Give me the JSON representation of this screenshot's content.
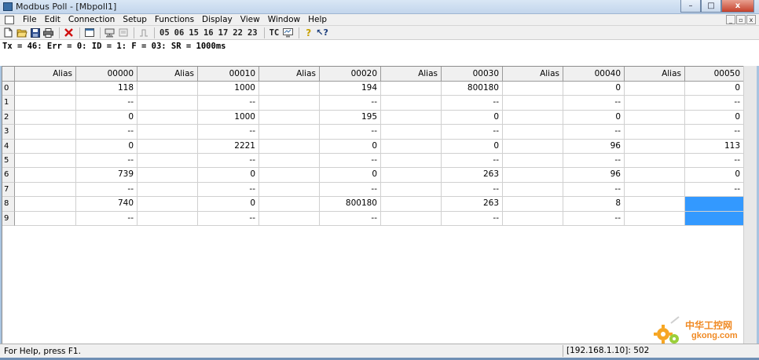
{
  "window": {
    "title": "Modbus Poll - [Mbpoll1]",
    "min_label": "–",
    "max_label": "□",
    "close_label": "x"
  },
  "menu": {
    "items": [
      "File",
      "Edit",
      "Connection",
      "Setup",
      "Functions",
      "Display",
      "View",
      "Window",
      "Help"
    ],
    "mdi_min": "_",
    "mdi_restore": "▫",
    "mdi_close": "x"
  },
  "toolbar": {
    "function_codes": [
      "05",
      "06",
      "15",
      "16",
      "17",
      "22",
      "23"
    ],
    "tc_label": "TC",
    "help_label": "?",
    "context_help_label": "↖?"
  },
  "status_line": "Tx = 46: Err = 0: ID = 1: F = 03: SR = 1000ms",
  "grid": {
    "columns": [
      "Alias",
      "00000",
      "Alias",
      "00010",
      "Alias",
      "00020",
      "Alias",
      "00030",
      "Alias",
      "00040",
      "Alias",
      "00050"
    ],
    "rows": [
      {
        "index": "0",
        "cells": [
          "",
          "118",
          "",
          "1000",
          "",
          "194",
          "",
          "800180",
          "",
          "0",
          "",
          "0"
        ]
      },
      {
        "index": "1",
        "cells": [
          "",
          "--",
          "",
          "--",
          "",
          "--",
          "",
          "--",
          "",
          "--",
          "",
          "--"
        ]
      },
      {
        "index": "2",
        "cells": [
          "",
          "0",
          "",
          "1000",
          "",
          "195",
          "",
          "0",
          "",
          "0",
          "",
          "0"
        ]
      },
      {
        "index": "3",
        "cells": [
          "",
          "--",
          "",
          "--",
          "",
          "--",
          "",
          "--",
          "",
          "--",
          "",
          "--"
        ]
      },
      {
        "index": "4",
        "cells": [
          "",
          "0",
          "",
          "2221",
          "",
          "0",
          "",
          "0",
          "",
          "96",
          "",
          "113"
        ]
      },
      {
        "index": "5",
        "cells": [
          "",
          "--",
          "",
          "--",
          "",
          "--",
          "",
          "--",
          "",
          "--",
          "",
          "--"
        ]
      },
      {
        "index": "6",
        "cells": [
          "",
          "739",
          "",
          "0",
          "",
          "0",
          "",
          "263",
          "",
          "96",
          "",
          "0"
        ]
      },
      {
        "index": "7",
        "cells": [
          "",
          "--",
          "",
          "--",
          "",
          "--",
          "",
          "--",
          "",
          "--",
          "",
          "--"
        ]
      },
      {
        "index": "8",
        "cells": [
          "",
          "740",
          "",
          "0",
          "",
          "800180",
          "",
          "263",
          "",
          "8",
          "",
          ""
        ]
      },
      {
        "index": "9",
        "cells": [
          "",
          "--",
          "",
          "--",
          "",
          "--",
          "",
          "--",
          "",
          "--",
          "",
          ""
        ]
      }
    ],
    "selected_color": "#3399ff"
  },
  "statusbar": {
    "help_text": "For Help, press F1.",
    "connection": "[192.168.1.10]: 502"
  },
  "watermark": {
    "text_cn": "中华工控网",
    "text_en": "gkong.com"
  }
}
